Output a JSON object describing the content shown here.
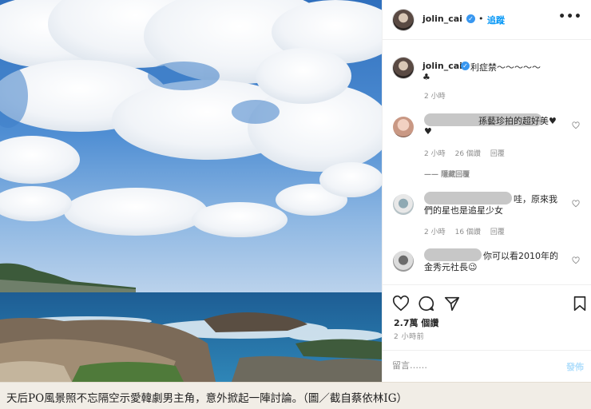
{
  "post": {
    "username": "jolin_cai",
    "dot": "•",
    "follow_label": "追蹤",
    "more_label": "•••"
  },
  "caption": {
    "username": "jolin_cai",
    "text": "利症禁～～～～～",
    "text_line2": "♣",
    "time": "2 小時"
  },
  "comments": [
    {
      "text_line1": "孫藝珍拍的超好美♥",
      "text_line2": "♥",
      "time": "2 小時",
      "likes": "26 個讚",
      "reply": "回覆",
      "view_replies": "—— 隱藏回覆"
    },
    {
      "text_line1": "哇，原來我",
      "text_line2": "們的星也是追星少女",
      "time": "2 小時",
      "likes": "16 個讚",
      "reply": "回覆"
    },
    {
      "text_line1": "你可以看2010年的",
      "text_line2": "金秀元社長😉",
      "time": "",
      "likes": "",
      "reply": ""
    }
  ],
  "stats": {
    "likes": "2.7萬 個讚",
    "time": "2 小時前"
  },
  "comment_box": {
    "placeholder": "留言……",
    "post_label": "發佈"
  },
  "article_caption": "天后PO風景照不忘隔空示愛韓劇男主角，意外掀起一陣討論。（圖／截自蔡依林IG）",
  "colors": {
    "link_blue": "#0095f6",
    "verified_blue": "#3897f0",
    "meta_gray": "#8e8e8e",
    "caption_bg": "#f1ede6"
  }
}
